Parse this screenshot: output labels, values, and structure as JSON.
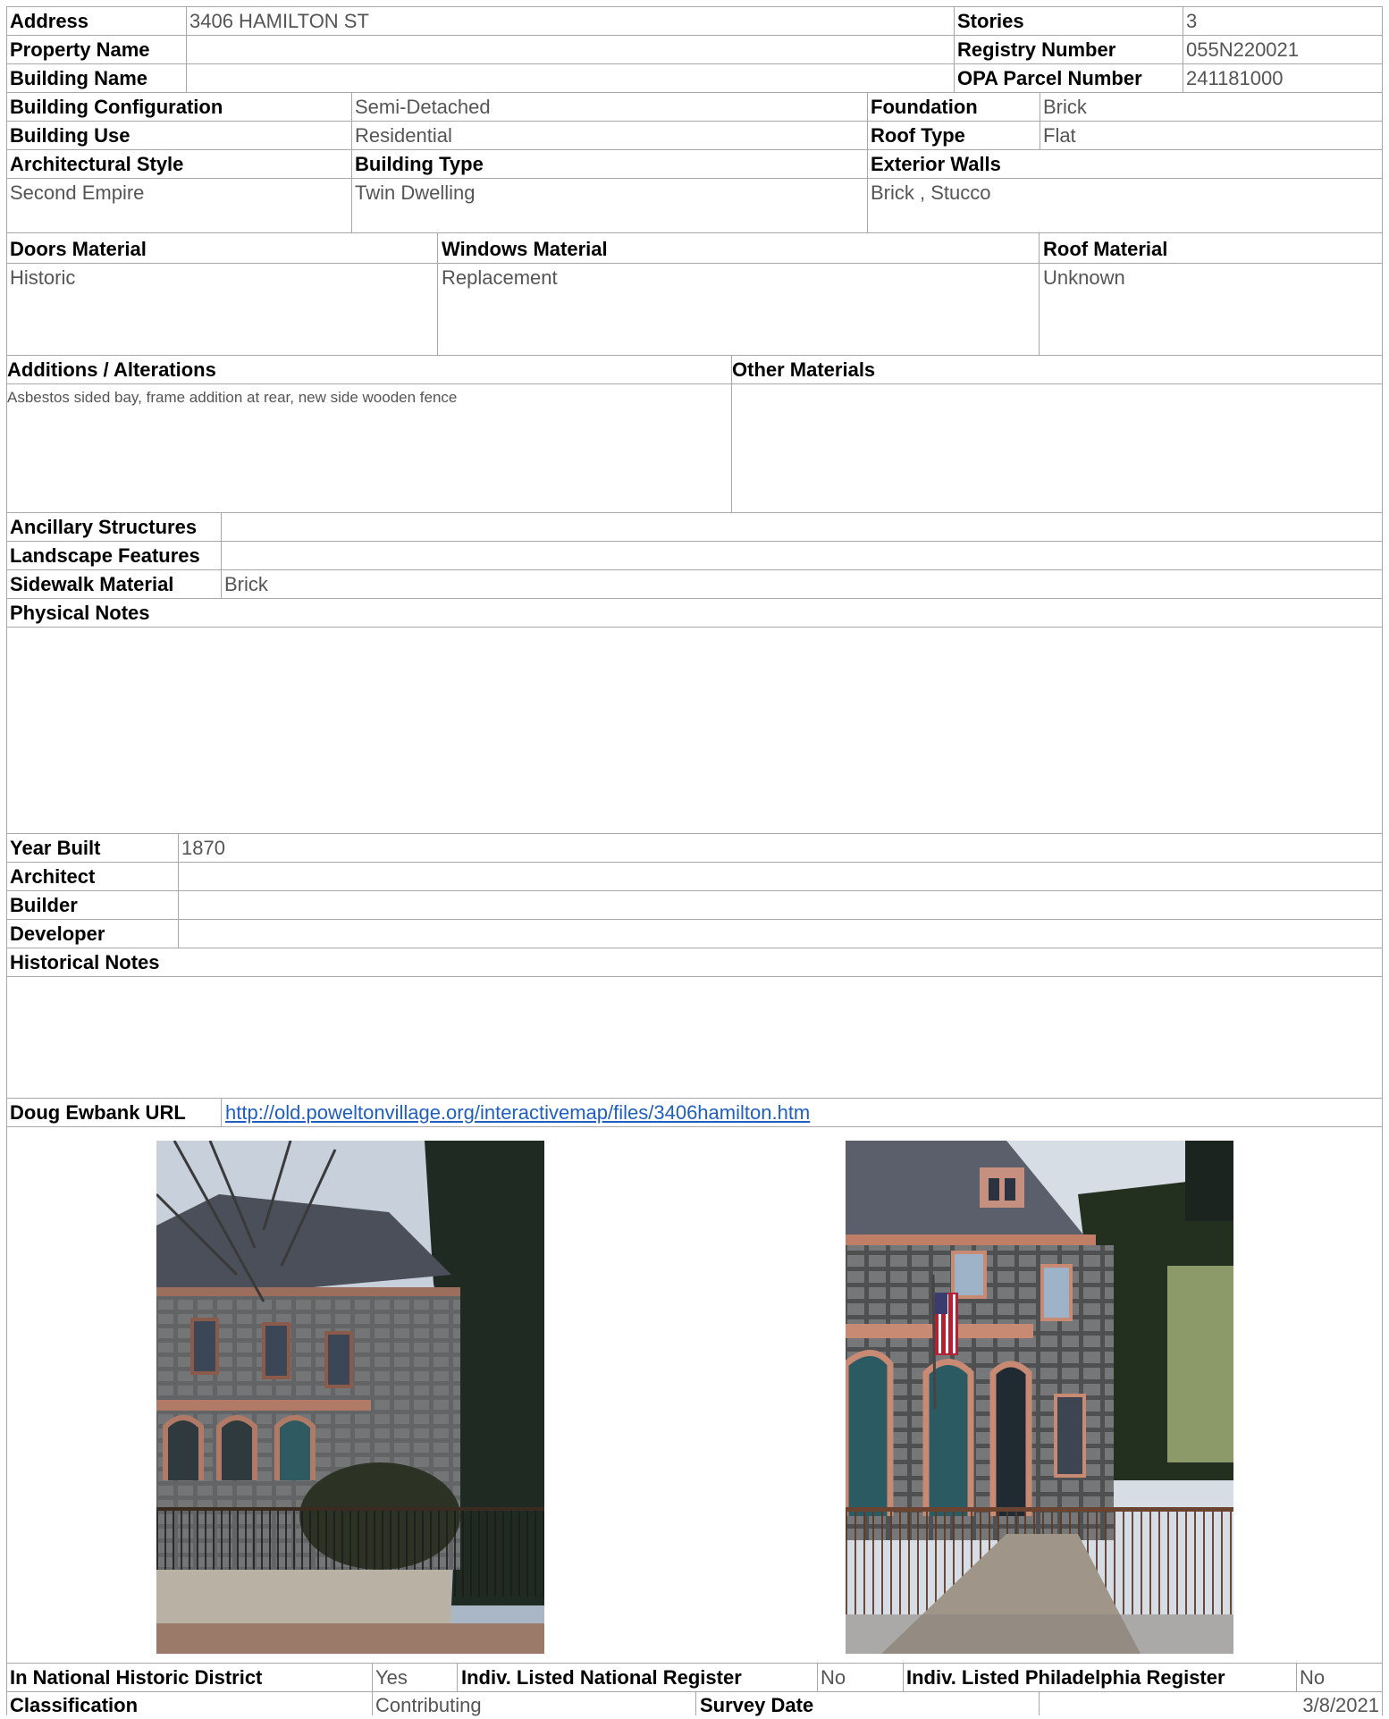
{
  "header": {
    "address_label": "Address",
    "address": "3406 HAMILTON ST",
    "property_name_label": "Property Name",
    "property_name": "",
    "building_name_label": "Building Name",
    "building_name": "",
    "stories_label": "Stories",
    "stories": "3",
    "registry_number_label": "Registry Number",
    "registry_number": "055N220021",
    "opa_label": "OPA Parcel Number",
    "opa": "241181000"
  },
  "building": {
    "configuration_label": "Building Configuration",
    "configuration": "Semi-Detached",
    "use_label": "Building Use",
    "use": "Residential",
    "foundation_label": "Foundation",
    "foundation": "Brick",
    "roof_type_label": "Roof Type",
    "roof_type": "Flat",
    "style_label": "Architectural Style",
    "style": "Second Empire",
    "type_label": "Building Type",
    "type": "Twin Dwelling",
    "walls_label": "Exterior Walls",
    "walls": "Brick , Stucco"
  },
  "materials": {
    "doors_label": "Doors Material",
    "doors": "Historic",
    "windows_label": "Windows Material",
    "windows": "Replacement",
    "roof_label": "Roof Material",
    "roof": "Unknown"
  },
  "alterations": {
    "label": "Additions / Alterations",
    "text": "Asbestos sided bay, frame addition at rear, new side wooden fence",
    "other_label": "Other Materials",
    "other": ""
  },
  "site": {
    "ancillary_label": "Ancillary Structures",
    "ancillary": "",
    "landscape_label": "Landscape Features",
    "landscape": "",
    "sidewalk_label": "Sidewalk Material",
    "sidewalk": "Brick",
    "physical_notes_label": "Physical Notes",
    "physical_notes": ""
  },
  "history": {
    "year_label": "Year Built",
    "year": "1870",
    "architect_label": "Architect",
    "architect": "",
    "builder_label": "Builder",
    "builder": "",
    "developer_label": "Developer",
    "developer": "",
    "notes_label": "Historical Notes",
    "notes": "",
    "url_label": "Doug Ewbank URL",
    "url": "http://old.poweltonvillage.org/interactivemap/files/3406hamilton.htm"
  },
  "footer": {
    "district_label": "In National Historic District",
    "district": "Yes",
    "national_label": "Indiv. Listed National Register",
    "national": "No",
    "phila_label": "Indiv. Listed Philadelphia Register",
    "phila": "No",
    "classification_label": "Classification",
    "classification": "Contributing",
    "survey_label": "Survey Date",
    "survey": "3/8/2021"
  },
  "colors": {
    "label": "#000000",
    "value": "#555555",
    "rule": "#a8a8a8",
    "link": "#1f5fbf"
  }
}
